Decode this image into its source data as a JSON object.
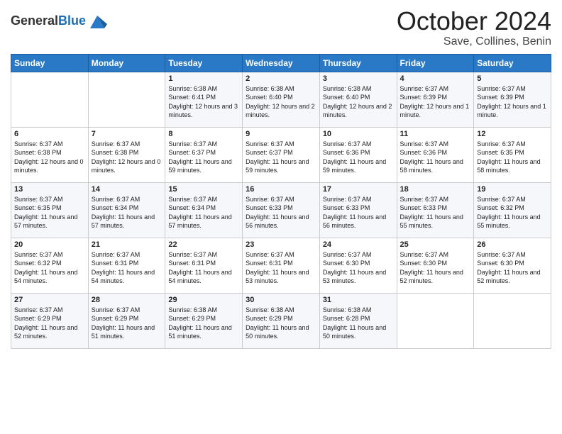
{
  "header": {
    "logo_general": "General",
    "logo_blue": "Blue",
    "title": "October 2024",
    "location": "Save, Collines, Benin"
  },
  "days_of_week": [
    "Sunday",
    "Monday",
    "Tuesday",
    "Wednesday",
    "Thursday",
    "Friday",
    "Saturday"
  ],
  "weeks": [
    [
      {
        "day": "",
        "sunrise": "",
        "sunset": "",
        "daylight": ""
      },
      {
        "day": "",
        "sunrise": "",
        "sunset": "",
        "daylight": ""
      },
      {
        "day": "1",
        "sunrise": "Sunrise: 6:38 AM",
        "sunset": "Sunset: 6:41 PM",
        "daylight": "Daylight: 12 hours and 3 minutes."
      },
      {
        "day": "2",
        "sunrise": "Sunrise: 6:38 AM",
        "sunset": "Sunset: 6:40 PM",
        "daylight": "Daylight: 12 hours and 2 minutes."
      },
      {
        "day": "3",
        "sunrise": "Sunrise: 6:38 AM",
        "sunset": "Sunset: 6:40 PM",
        "daylight": "Daylight: 12 hours and 2 minutes."
      },
      {
        "day": "4",
        "sunrise": "Sunrise: 6:37 AM",
        "sunset": "Sunset: 6:39 PM",
        "daylight": "Daylight: 12 hours and 1 minute."
      },
      {
        "day": "5",
        "sunrise": "Sunrise: 6:37 AM",
        "sunset": "Sunset: 6:39 PM",
        "daylight": "Daylight: 12 hours and 1 minute."
      }
    ],
    [
      {
        "day": "6",
        "sunrise": "Sunrise: 6:37 AM",
        "sunset": "Sunset: 6:38 PM",
        "daylight": "Daylight: 12 hours and 0 minutes."
      },
      {
        "day": "7",
        "sunrise": "Sunrise: 6:37 AM",
        "sunset": "Sunset: 6:38 PM",
        "daylight": "Daylight: 12 hours and 0 minutes."
      },
      {
        "day": "8",
        "sunrise": "Sunrise: 6:37 AM",
        "sunset": "Sunset: 6:37 PM",
        "daylight": "Daylight: 11 hours and 59 minutes."
      },
      {
        "day": "9",
        "sunrise": "Sunrise: 6:37 AM",
        "sunset": "Sunset: 6:37 PM",
        "daylight": "Daylight: 11 hours and 59 minutes."
      },
      {
        "day": "10",
        "sunrise": "Sunrise: 6:37 AM",
        "sunset": "Sunset: 6:36 PM",
        "daylight": "Daylight: 11 hours and 59 minutes."
      },
      {
        "day": "11",
        "sunrise": "Sunrise: 6:37 AM",
        "sunset": "Sunset: 6:36 PM",
        "daylight": "Daylight: 11 hours and 58 minutes."
      },
      {
        "day": "12",
        "sunrise": "Sunrise: 6:37 AM",
        "sunset": "Sunset: 6:35 PM",
        "daylight": "Daylight: 11 hours and 58 minutes."
      }
    ],
    [
      {
        "day": "13",
        "sunrise": "Sunrise: 6:37 AM",
        "sunset": "Sunset: 6:35 PM",
        "daylight": "Daylight: 11 hours and 57 minutes."
      },
      {
        "day": "14",
        "sunrise": "Sunrise: 6:37 AM",
        "sunset": "Sunset: 6:34 PM",
        "daylight": "Daylight: 11 hours and 57 minutes."
      },
      {
        "day": "15",
        "sunrise": "Sunrise: 6:37 AM",
        "sunset": "Sunset: 6:34 PM",
        "daylight": "Daylight: 11 hours and 57 minutes."
      },
      {
        "day": "16",
        "sunrise": "Sunrise: 6:37 AM",
        "sunset": "Sunset: 6:33 PM",
        "daylight": "Daylight: 11 hours and 56 minutes."
      },
      {
        "day": "17",
        "sunrise": "Sunrise: 6:37 AM",
        "sunset": "Sunset: 6:33 PM",
        "daylight": "Daylight: 11 hours and 56 minutes."
      },
      {
        "day": "18",
        "sunrise": "Sunrise: 6:37 AM",
        "sunset": "Sunset: 6:33 PM",
        "daylight": "Daylight: 11 hours and 55 minutes."
      },
      {
        "day": "19",
        "sunrise": "Sunrise: 6:37 AM",
        "sunset": "Sunset: 6:32 PM",
        "daylight": "Daylight: 11 hours and 55 minutes."
      }
    ],
    [
      {
        "day": "20",
        "sunrise": "Sunrise: 6:37 AM",
        "sunset": "Sunset: 6:32 PM",
        "daylight": "Daylight: 11 hours and 54 minutes."
      },
      {
        "day": "21",
        "sunrise": "Sunrise: 6:37 AM",
        "sunset": "Sunset: 6:31 PM",
        "daylight": "Daylight: 11 hours and 54 minutes."
      },
      {
        "day": "22",
        "sunrise": "Sunrise: 6:37 AM",
        "sunset": "Sunset: 6:31 PM",
        "daylight": "Daylight: 11 hours and 54 minutes."
      },
      {
        "day": "23",
        "sunrise": "Sunrise: 6:37 AM",
        "sunset": "Sunset: 6:31 PM",
        "daylight": "Daylight: 11 hours and 53 minutes."
      },
      {
        "day": "24",
        "sunrise": "Sunrise: 6:37 AM",
        "sunset": "Sunset: 6:30 PM",
        "daylight": "Daylight: 11 hours and 53 minutes."
      },
      {
        "day": "25",
        "sunrise": "Sunrise: 6:37 AM",
        "sunset": "Sunset: 6:30 PM",
        "daylight": "Daylight: 11 hours and 52 minutes."
      },
      {
        "day": "26",
        "sunrise": "Sunrise: 6:37 AM",
        "sunset": "Sunset: 6:30 PM",
        "daylight": "Daylight: 11 hours and 52 minutes."
      }
    ],
    [
      {
        "day": "27",
        "sunrise": "Sunrise: 6:37 AM",
        "sunset": "Sunset: 6:29 PM",
        "daylight": "Daylight: 11 hours and 52 minutes."
      },
      {
        "day": "28",
        "sunrise": "Sunrise: 6:37 AM",
        "sunset": "Sunset: 6:29 PM",
        "daylight": "Daylight: 11 hours and 51 minutes."
      },
      {
        "day": "29",
        "sunrise": "Sunrise: 6:38 AM",
        "sunset": "Sunset: 6:29 PM",
        "daylight": "Daylight: 11 hours and 51 minutes."
      },
      {
        "day": "30",
        "sunrise": "Sunrise: 6:38 AM",
        "sunset": "Sunset: 6:29 PM",
        "daylight": "Daylight: 11 hours and 50 minutes."
      },
      {
        "day": "31",
        "sunrise": "Sunrise: 6:38 AM",
        "sunset": "Sunset: 6:28 PM",
        "daylight": "Daylight: 11 hours and 50 minutes."
      },
      {
        "day": "",
        "sunrise": "",
        "sunset": "",
        "daylight": ""
      },
      {
        "day": "",
        "sunrise": "",
        "sunset": "",
        "daylight": ""
      }
    ]
  ]
}
